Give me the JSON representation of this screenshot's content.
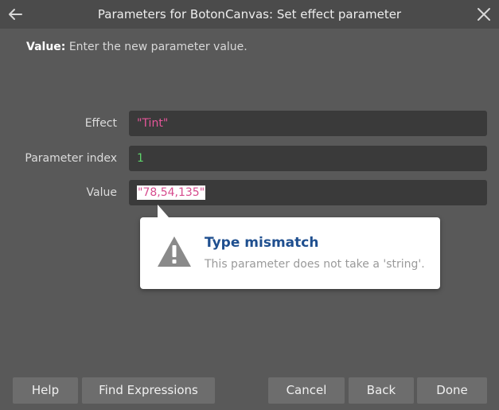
{
  "window": {
    "title": "Parameters for BotonCanvas: Set effect parameter"
  },
  "description": {
    "label": "Value:",
    "text": " Enter the new parameter value."
  },
  "params": [
    {
      "label": "Effect",
      "value": "\"Tint\""
    },
    {
      "label": "Parameter index",
      "value": "1"
    },
    {
      "label": "Value",
      "value": "\"78,54,135\""
    }
  ],
  "tooltip": {
    "title": "Type mismatch",
    "message": "This parameter does not take a 'string'."
  },
  "buttons": {
    "help": "Help",
    "find_expressions": "Find Expressions",
    "cancel": "Cancel",
    "back": "Back",
    "done": "Done"
  },
  "colors": {
    "string_value": "#e6569a",
    "number_value": "#5ed36a",
    "tooltip_title": "#1f4f8f"
  }
}
